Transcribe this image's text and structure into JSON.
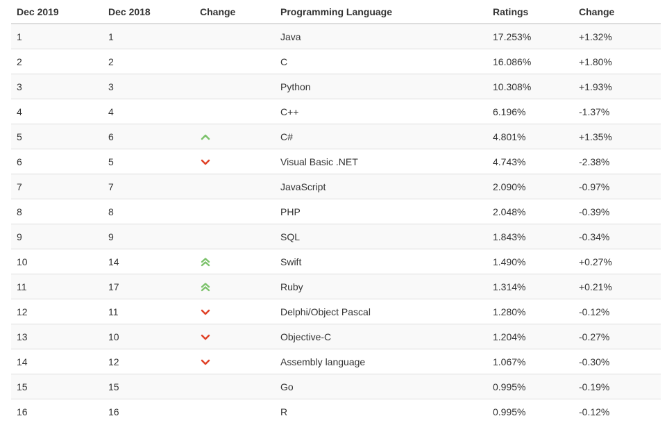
{
  "table": {
    "headers": [
      "Dec 2019",
      "Dec 2018",
      "Change",
      "Programming Language",
      "Ratings",
      "Change"
    ],
    "rows": [
      {
        "dec2019": "1",
        "dec2018": "1",
        "trend": "none",
        "language": "Java",
        "rating": "17.253%",
        "change": "+1.32%"
      },
      {
        "dec2019": "2",
        "dec2018": "2",
        "trend": "none",
        "language": "C",
        "rating": "16.086%",
        "change": "+1.80%"
      },
      {
        "dec2019": "3",
        "dec2018": "3",
        "trend": "none",
        "language": "Python",
        "rating": "10.308%",
        "change": "+1.93%"
      },
      {
        "dec2019": "4",
        "dec2018": "4",
        "trend": "none",
        "language": "C++",
        "rating": "6.196%",
        "change": "-1.37%"
      },
      {
        "dec2019": "5",
        "dec2018": "6",
        "trend": "up",
        "language": "C#",
        "rating": "4.801%",
        "change": "+1.35%"
      },
      {
        "dec2019": "6",
        "dec2018": "5",
        "trend": "down",
        "language": "Visual Basic .NET",
        "rating": "4.743%",
        "change": "-2.38%"
      },
      {
        "dec2019": "7",
        "dec2018": "7",
        "trend": "none",
        "language": "JavaScript",
        "rating": "2.090%",
        "change": "-0.97%"
      },
      {
        "dec2019": "8",
        "dec2018": "8",
        "trend": "none",
        "language": "PHP",
        "rating": "2.048%",
        "change": "-0.39%"
      },
      {
        "dec2019": "9",
        "dec2018": "9",
        "trend": "none",
        "language": "SQL",
        "rating": "1.843%",
        "change": "-0.34%"
      },
      {
        "dec2019": "10",
        "dec2018": "14",
        "trend": "up-double",
        "language": "Swift",
        "rating": "1.490%",
        "change": "+0.27%"
      },
      {
        "dec2019": "11",
        "dec2018": "17",
        "trend": "up-double",
        "language": "Ruby",
        "rating": "1.314%",
        "change": "+0.21%"
      },
      {
        "dec2019": "12",
        "dec2018": "11",
        "trend": "down",
        "language": "Delphi/Object Pascal",
        "rating": "1.280%",
        "change": "-0.12%"
      },
      {
        "dec2019": "13",
        "dec2018": "10",
        "trend": "down",
        "language": "Objective-C",
        "rating": "1.204%",
        "change": "-0.27%"
      },
      {
        "dec2019": "14",
        "dec2018": "12",
        "trend": "down",
        "language": "Assembly language",
        "rating": "1.067%",
        "change": "-0.30%"
      },
      {
        "dec2019": "15",
        "dec2018": "15",
        "trend": "none",
        "language": "Go",
        "rating": "0.995%",
        "change": "-0.19%"
      },
      {
        "dec2019": "16",
        "dec2018": "16",
        "trend": "none",
        "language": "R",
        "rating": "0.995%",
        "change": "-0.12%"
      }
    ]
  },
  "icons": {
    "up": "chevron-up-icon",
    "up-double": "double-chevron-up-icon",
    "down": "chevron-down-icon"
  },
  "colors": {
    "up": "#7cc26b",
    "down": "#e0442a",
    "stripe": "#f9f9f9",
    "border": "#dddddd",
    "text": "#333333"
  }
}
